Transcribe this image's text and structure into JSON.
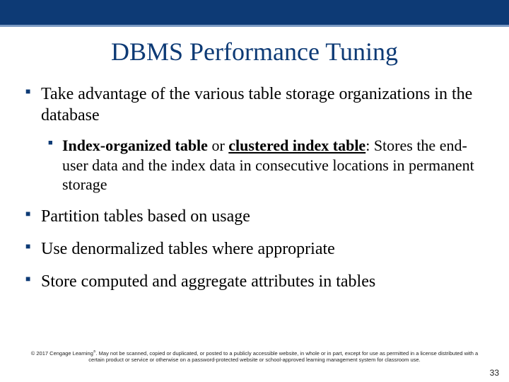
{
  "title": "DBMS Performance Tuning",
  "bullets": {
    "b1": "Take advantage of the various table storage organizations in the database",
    "b1_sub_term1": "Index-organized table",
    "b1_sub_or": " or ",
    "b1_sub_term2": "clustered index table",
    "b1_sub_rest": ": Stores the end-user data and the index data in consecutive locations in permanent storage",
    "b2": "Partition tables based on usage",
    "b3": "Use denormalized tables where appropriate",
    "b4": "Store computed and aggregate attributes in tables"
  },
  "footer": {
    "copyright_prefix": "© 2017 Cengage Learning",
    "reg": "®",
    "copyright_rest": ". May not be scanned, copied or duplicated, or posted to a publicly accessible website, in whole or in part, except for use as permitted in a license distributed with a certain product or service or otherwise on a password-protected website or school-approved learning management system for classroom use."
  },
  "page_number": "33"
}
